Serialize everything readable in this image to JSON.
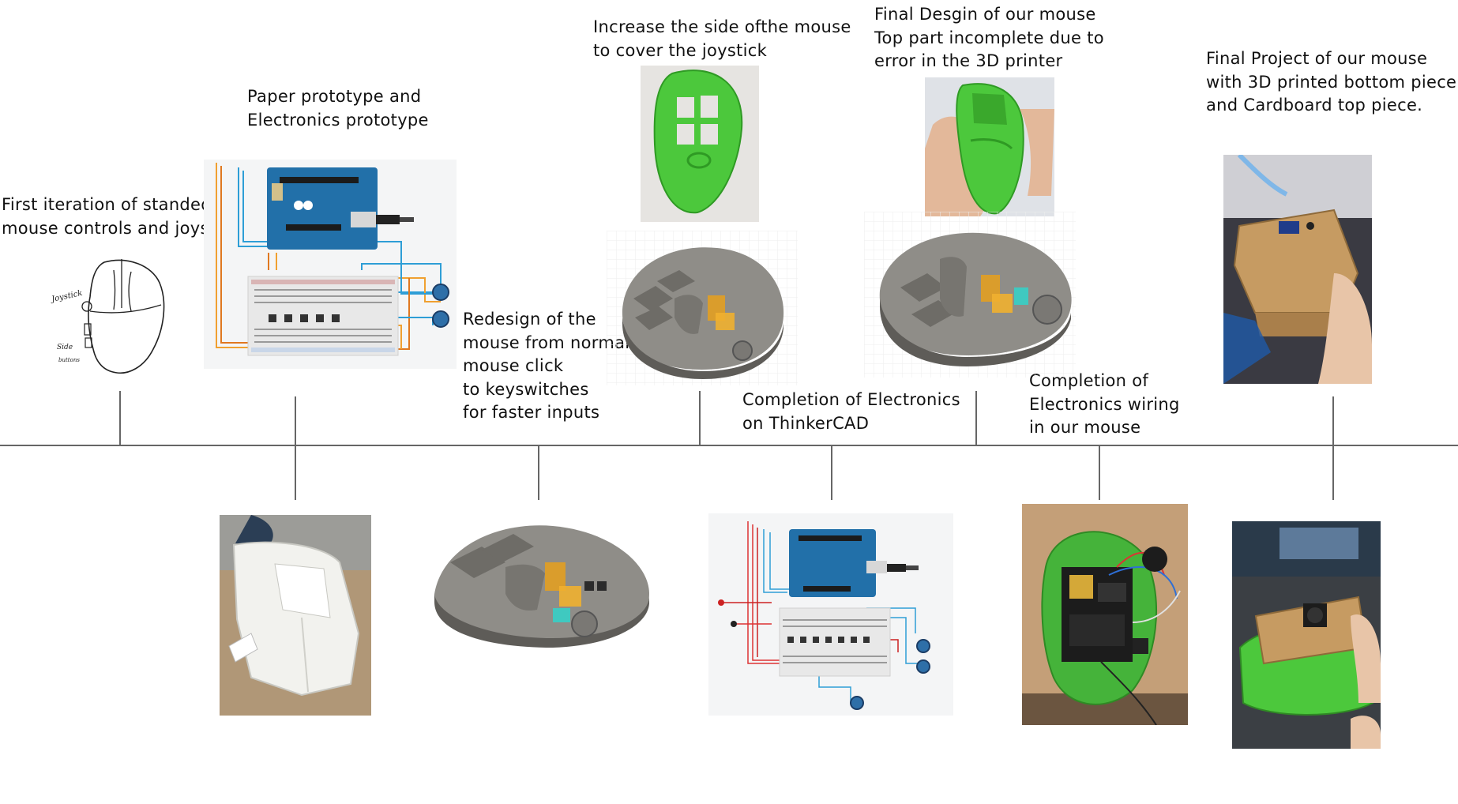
{
  "timeline": {
    "captions": {
      "first_iteration": "First iteration of standed\nmouse controls and joystick",
      "paper_prototype": "Paper prototype and\nElectronics prototype",
      "redesign": "Redesign of the\nmouse from normal\nmouse click\nto keyswitches\nfor faster inputs",
      "increase_side": "Increase the side ofthe mouse\nto cover the joystick",
      "completion_thinkercad": "Completion of Electronics\non ThinkerCAD",
      "final_design": "Final Desgin of our mouse\nTop part incomplete due to\nerror in the 3D printer",
      "completion_wiring": "Completion of\nElectronics wiring\nin our mouse",
      "final_project": "Final Project of our mouse\nwith 3D printed bottom piece\nand Cardboard top piece."
    },
    "sketch_labels": {
      "joystick": "Joystick",
      "side_line1": "Side",
      "side_line2": "buttons"
    },
    "colors": {
      "axis": "#666666",
      "mouse_green": "#4cc83c",
      "mouse_grey": "#8f8d88",
      "arduino_blue": "#2270a9",
      "cardboard": "#c69b62"
    },
    "icons": {
      "sketch": "hand-drawn-mouse-sketch",
      "paper_model": "white-paper-mouse-photo",
      "cad": "grey-cad-mouse-render",
      "circuit": "arduino-breadboard-circuit",
      "green_print": "green-3d-printed-mouse-photo",
      "wired": "wired-green-mouse-photo",
      "cardboard": "cardboard-mouse-photo"
    }
  }
}
